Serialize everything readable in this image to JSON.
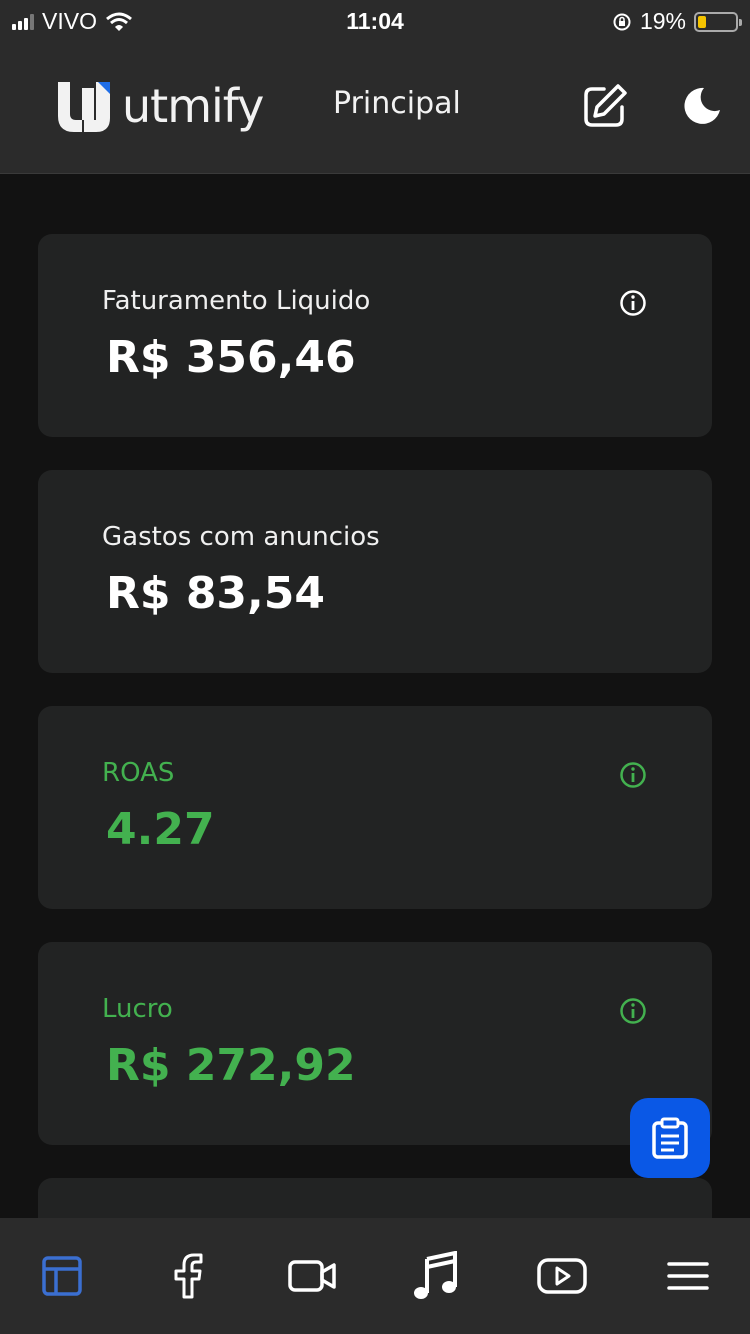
{
  "status_bar": {
    "carrier": "VIVO",
    "time": "11:04",
    "battery": "19%",
    "battery_level": 0.19
  },
  "header": {
    "logo_text": "utmify",
    "title": "Principal",
    "edit_icon": "edit-icon",
    "theme_icon": "moon-icon"
  },
  "cards": [
    {
      "label": "Faturamento Liquido",
      "value": "R$ 356,46",
      "has_info": true,
      "color": "#ffffff"
    },
    {
      "label": "Gastos com anuncios",
      "value": "R$ 83,54",
      "has_info": false,
      "color": "#ffffff"
    },
    {
      "label": "ROAS",
      "value": "4.27",
      "has_info": true,
      "color": "#43b14f"
    },
    {
      "label": "Lucro",
      "value": "R$ 272,92",
      "has_info": true,
      "color": "#43b14f"
    }
  ],
  "fab": {
    "icon": "clipboard-icon"
  },
  "bottom_nav": [
    {
      "icon": "dashboard-icon",
      "active": true
    },
    {
      "icon": "facebook-icon",
      "active": false
    },
    {
      "icon": "video-camera-icon",
      "active": false
    },
    {
      "icon": "music-note-icon",
      "active": false
    },
    {
      "icon": "youtube-icon",
      "active": false
    },
    {
      "icon": "menu-icon",
      "active": false
    }
  ],
  "colors": {
    "accent": "#0a58e6",
    "positive": "#43b14f",
    "active_nav": "#3b6fd1"
  }
}
